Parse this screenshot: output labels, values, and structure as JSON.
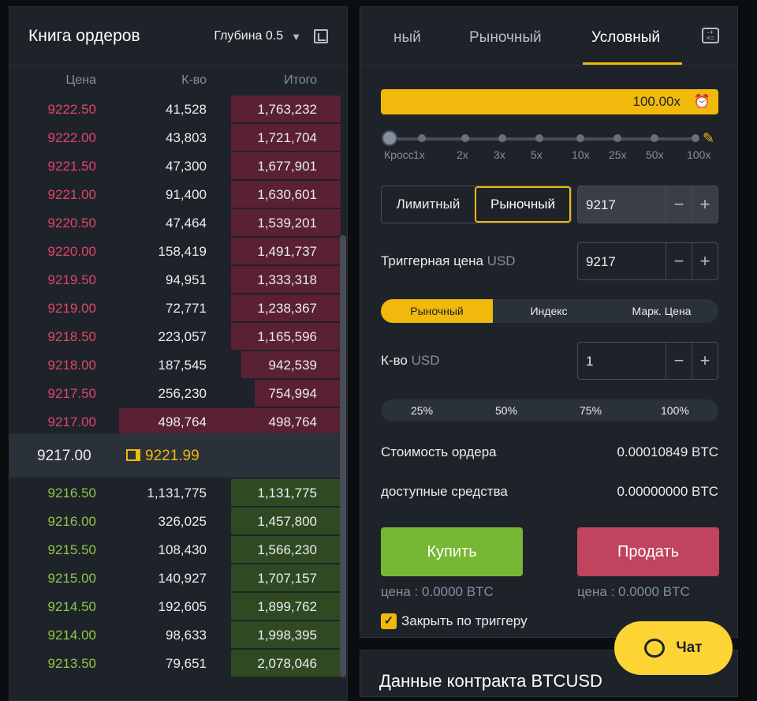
{
  "orderbook": {
    "title": "Книга ордеров",
    "depth_label": "Глубина 0.5",
    "col_price": "Цена",
    "col_qty": "К-во",
    "col_total": "Итого",
    "asks": [
      {
        "price": "9222.50",
        "qty": "41,528",
        "total": "1,763,232",
        "fill": 0.33
      },
      {
        "price": "9222.00",
        "qty": "43,803",
        "total": "1,721,704",
        "fill": 0.33
      },
      {
        "price": "9221.50",
        "qty": "47,300",
        "total": "1,677,901",
        "fill": 0.33
      },
      {
        "price": "9221.00",
        "qty": "91,400",
        "total": "1,630,601",
        "fill": 0.33
      },
      {
        "price": "9220.50",
        "qty": "47,464",
        "total": "1,539,201",
        "fill": 0.33
      },
      {
        "price": "9220.00",
        "qty": "158,419",
        "total": "1,491,737",
        "fill": 0.33
      },
      {
        "price": "9219.50",
        "qty": "94,951",
        "total": "1,333,318",
        "fill": 0.33
      },
      {
        "price": "9219.00",
        "qty": "72,771",
        "total": "1,238,367",
        "fill": 0.33
      },
      {
        "price": "9218.50",
        "qty": "223,057",
        "total": "1,165,596",
        "fill": 0.33
      },
      {
        "price": "9218.00",
        "qty": "187,545",
        "total": "942,539",
        "fill": 0.3
      },
      {
        "price": "9217.50",
        "qty": "256,230",
        "total": "754,994",
        "fill": 0.26
      },
      {
        "price": "9217.00",
        "qty": "498,764",
        "total": "498,764",
        "fill": 0.67
      }
    ],
    "mid_last": "9217.00",
    "mid_mark": "9221.99",
    "bids": [
      {
        "price": "9216.50",
        "qty": "1,131,775",
        "total": "1,131,775",
        "fill": 0.33
      },
      {
        "price": "9216.00",
        "qty": "326,025",
        "total": "1,457,800",
        "fill": 0.33
      },
      {
        "price": "9215.50",
        "qty": "108,430",
        "total": "1,566,230",
        "fill": 0.33
      },
      {
        "price": "9215.00",
        "qty": "140,927",
        "total": "1,707,157",
        "fill": 0.33
      },
      {
        "price": "9214.50",
        "qty": "192,605",
        "total": "1,899,762",
        "fill": 0.33
      },
      {
        "price": "9214.00",
        "qty": "98,633",
        "total": "1,998,395",
        "fill": 0.33
      },
      {
        "price": "9213.50",
        "qty": "79,651",
        "total": "2,078,046",
        "fill": 0.33
      }
    ]
  },
  "trade": {
    "tabs": [
      "ный",
      "Рыночный",
      "Условный"
    ],
    "active_tab": "Условный",
    "leverage": "100.00x",
    "leverage_levels": [
      "Кросс",
      "1x",
      "2x",
      "3x",
      "5x",
      "10x",
      "25x",
      "50x",
      "100x"
    ],
    "type_limit": "Лимитный",
    "type_market": "Рыночный",
    "price_value": "9217",
    "trigger_label": "Триггерная цена",
    "trigger_unit": "USD",
    "trigger_value": "9217",
    "trigger_src": [
      "Рыночный",
      "Индекс",
      "Марк. Цена"
    ],
    "qty_label": "К-во",
    "qty_unit": "USD",
    "qty_value": "1",
    "pcts": [
      "25%",
      "50%",
      "75%",
      "100%"
    ],
    "cost_label": "Стоимость ордера",
    "cost_value": "0.00010849 BTC",
    "avail_label": "доступные средства",
    "avail_value": "0.00000000 BTC",
    "buy_label": "Купить",
    "sell_label": "Продать",
    "buy_cost": "цена : 0.0000 BTC",
    "sell_cost": "цена : 0.0000 BTC",
    "close_on_trigger": "Закрыть по триггеру"
  },
  "contract_info_title": "Данные контракта BTCUSD",
  "chat_label": "Чат"
}
